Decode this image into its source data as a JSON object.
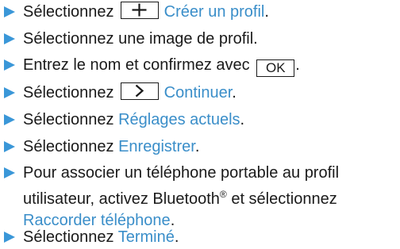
{
  "colors": {
    "arrow": "#3a97d8",
    "link": "#3a8ec9",
    "text": "#1a1a1a"
  },
  "steps": [
    {
      "prefix": "Sélectionnez",
      "key_icon": "plus-icon",
      "link": "Créer un profil",
      "suffix": "."
    },
    {
      "text": "Sélectionnez une image de profil."
    },
    {
      "prefix": "Entrez le nom et confirmez avec",
      "key_label": "OK",
      "suffix": "."
    },
    {
      "prefix": "Sélectionnez",
      "key_icon": "chevron-right-icon",
      "link": "Continuer",
      "suffix": "."
    },
    {
      "prefix": "Sélectionnez",
      "link": "Réglages actuels",
      "suffix": "."
    },
    {
      "prefix": "Sélectionnez",
      "link": "Enregistrer",
      "suffix": "."
    },
    {
      "line1": "Pour associer un téléphone portable au profil",
      "line2_prefix": "utilisateur, activez Bluetooth",
      "line2_sup": "®",
      "line2_suffix": " et sélectionnez",
      "line3_link": "Raccorder téléphone",
      "line3_suffix": "."
    },
    {
      "prefix": "Sélectionnez",
      "link": "Terminé",
      "suffix": "."
    }
  ]
}
